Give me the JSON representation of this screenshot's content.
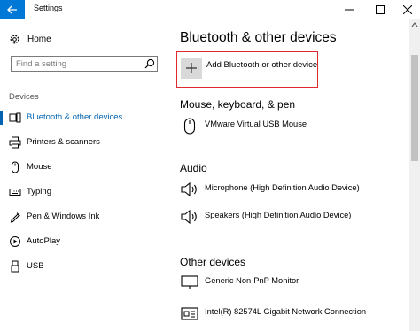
{
  "window": {
    "title": "Settings"
  },
  "sidebar": {
    "home_label": "Home",
    "search_placeholder": "Find a setting",
    "section_label": "Devices",
    "items": [
      {
        "label": "Bluetooth & other devices",
        "icon": "bluetooth-devices-icon",
        "active": true
      },
      {
        "label": "Printers & scanners",
        "icon": "printer-icon",
        "active": false
      },
      {
        "label": "Mouse",
        "icon": "mouse-icon",
        "active": false
      },
      {
        "label": "Typing",
        "icon": "keyboard-icon",
        "active": false
      },
      {
        "label": "Pen & Windows Ink",
        "icon": "pen-icon",
        "active": false
      },
      {
        "label": "AutoPlay",
        "icon": "autoplay-icon",
        "active": false
      },
      {
        "label": "USB",
        "icon": "usb-icon",
        "active": false
      }
    ]
  },
  "main": {
    "title": "Bluetooth & other devices",
    "add_label": "Add Bluetooth or other device",
    "sections": [
      {
        "title": "Mouse, keyboard, & pen",
        "devices": [
          {
            "name": "VMware Virtual USB Mouse",
            "icon": "mouse-icon"
          }
        ]
      },
      {
        "title": "Audio",
        "devices": [
          {
            "name": "Microphone (High Definition Audio Device)",
            "icon": "speaker-icon"
          },
          {
            "name": "Speakers (High Definition Audio Device)",
            "icon": "speaker-icon"
          }
        ]
      },
      {
        "title": "Other devices",
        "devices": [
          {
            "name": "Generic Non-PnP Monitor",
            "icon": "monitor-icon"
          },
          {
            "name": "Intel(R) 82574L Gigabit Network Connection",
            "icon": "network-adapter-icon"
          }
        ]
      }
    ]
  },
  "colors": {
    "accent": "#0078d7",
    "active_text": "#0063b1",
    "highlight_border": "#e0292f"
  }
}
